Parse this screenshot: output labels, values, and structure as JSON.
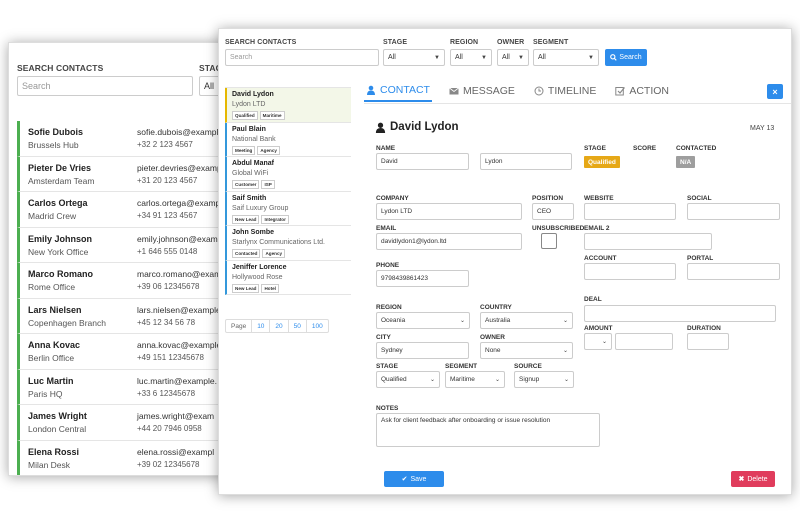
{
  "back_window": {
    "search_label": "SEARCH CONTACTS",
    "search_placeholder": "Search",
    "stage_label": "STAG",
    "stage_value": "All",
    "contacts": [
      {
        "name": "Sofie Dubois",
        "team": "Brussels Hub",
        "email": "sofie.dubois@example",
        "phone": "+32 2 123 4567"
      },
      {
        "name": "Pieter De Vries",
        "team": "Amsterdam Team",
        "email": "pieter.devries@example",
        "phone": "+31 20 123 4567"
      },
      {
        "name": "Carlos Ortega",
        "team": "Madrid Crew",
        "email": "carlos.ortega@example",
        "phone": "+34 91 123 4567"
      },
      {
        "name": "Emily Johnson",
        "team": "New York Office",
        "email": "emily.johnson@exampl",
        "phone": "+1 646 555 0148"
      },
      {
        "name": "Marco Romano",
        "team": "Rome Office",
        "email": "marco.romano@exam",
        "phone": "+39 06 12345678"
      },
      {
        "name": "Lars Nielsen",
        "team": "Copenhagen Branch",
        "email": "lars.nielsen@example",
        "phone": "+45 12 34 56 78"
      },
      {
        "name": "Anna Kovac",
        "team": "Berlin Office",
        "email": "anna.kovac@example.",
        "phone": "+49 151 12345678"
      },
      {
        "name": "Luc Martin",
        "team": "Paris HQ",
        "email": "luc.martin@example.",
        "phone": "+33 6 12345678"
      },
      {
        "name": "James Wright",
        "team": "London Central",
        "email": "james.wright@exam",
        "phone": "+44 20 7946 0958"
      },
      {
        "name": "Elena Rossi",
        "team": "Milan Desk",
        "email": "elena.rossi@exampl",
        "phone": "+39 02 12345678"
      }
    ],
    "accent_color": "#4caf50"
  },
  "filters": {
    "search_label": "SEARCH CONTACTS",
    "search_placeholder": "Search",
    "stage_label": "STAGE",
    "stage_value": "All",
    "region_label": "REGION",
    "region_value": "All",
    "owner_label": "OWNER",
    "owner_value": "All",
    "segment_label": "SEGMENT",
    "segment_value": "All",
    "search_button": "Search"
  },
  "contacts": [
    {
      "name": "David Lydon",
      "company": "Lydon LTD",
      "tags": [
        "Qualified",
        "Maritime"
      ]
    },
    {
      "name": "Paul Blain",
      "company": "National Bank",
      "tags": [
        "Meeting",
        "Agency"
      ]
    },
    {
      "name": "Abdul Manaf",
      "company": "Global WiFi",
      "tags": [
        "Customer",
        "ISP"
      ]
    },
    {
      "name": "Saif Smith",
      "company": "Saif Luxury Group",
      "tags": [
        "New Lead",
        "Integrator"
      ]
    },
    {
      "name": "John Sombe",
      "company": "Starlynx Communications Ltd.",
      "tags": [
        "Contacted",
        "Agency"
      ]
    },
    {
      "name": "Jeniffer Lorence",
      "company": "Hollywood Rose",
      "tags": [
        "New Lead",
        "Hotel"
      ]
    }
  ],
  "pager": {
    "label": "Page",
    "sizes": [
      "10",
      "20",
      "50",
      "100"
    ]
  },
  "tabs": {
    "contact": "CONTACT",
    "message": "MESSAGE",
    "timeline": "TIMELINE",
    "action": "ACTION"
  },
  "close_label": "×",
  "detail": {
    "title": "David Lydon",
    "date": "MAY 13",
    "name_label": "NAME",
    "first_name": "David",
    "last_name": "Lydon",
    "stage_label": "STAGE",
    "stage_value": "Qualified",
    "score_label": "SCORE",
    "contacted_label": "CONTACTED",
    "contacted_value": "N/A",
    "company_label": "COMPANY",
    "company_value": "Lydon LTD",
    "position_label": "POSITION",
    "position_value": "CEO",
    "website_label": "WEBSITE",
    "social_label": "SOCIAL",
    "email_label": "EMAIL",
    "email_value": "davidlydon1@lydon.ltd",
    "unsubscribed_label": "UNSUBSCRIBED",
    "email2_label": "EMAIL 2",
    "account_label": "ACCOUNT",
    "portal_label": "PORTAL",
    "phone_label": "PHONE",
    "phone_value": "9798439861423",
    "deal_label": "DEAL",
    "region_label": "REGION",
    "region_value": "Oceania",
    "country_label": "COUNTRY",
    "country_value": "Australia",
    "amount_label": "AMOUNT",
    "duration_label": "DURATION",
    "city_label": "CITY",
    "city_value": "Sydney",
    "owner_label": "OWNER",
    "owner_value": "None",
    "stage2_label": "STAGE",
    "stage2_value": "Qualified",
    "segment_label": "SEGMENT",
    "segment_value": "Maritime",
    "source_label": "SOURCE",
    "source_value": "Signup",
    "notes_label": "NOTES",
    "notes_value": "Ask for client feedback after onboarding or issue resolution",
    "save_label": "Save",
    "delete_label": "Delete"
  },
  "colors": {
    "primary": "#2d8ceb",
    "stage_badge": "#e6a817",
    "contacted_badge": "#9e9e9e",
    "delete": "#e03c5c"
  }
}
